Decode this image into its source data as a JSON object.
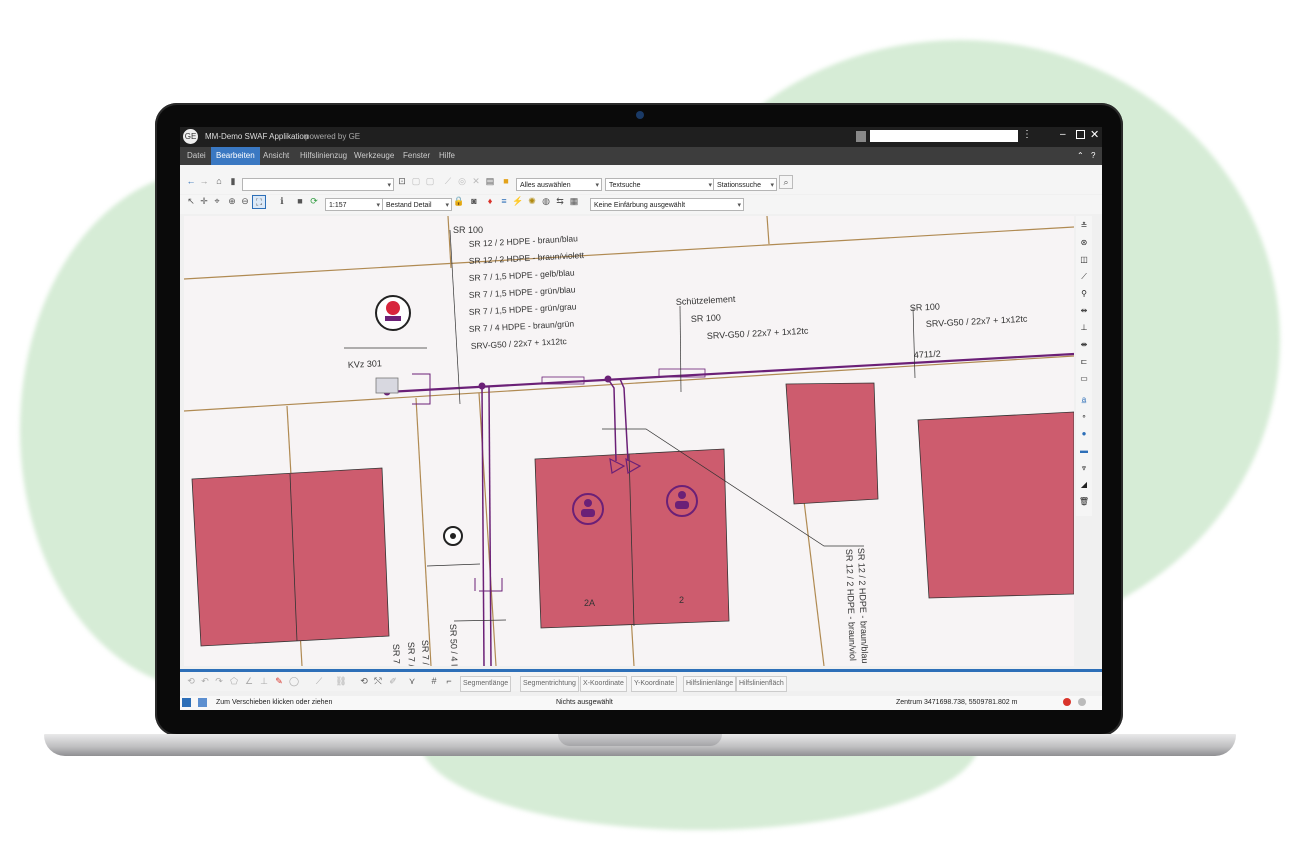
{
  "window": {
    "title": "MM-Demo SWAF Applikation",
    "subtitle": "powered by GE"
  },
  "menu": {
    "items": [
      {
        "label": "Datei",
        "active": false
      },
      {
        "label": "Bearbeiten",
        "active": true
      },
      {
        "label": "Ansicht",
        "active": false
      },
      {
        "label": "Hilfslinienzug",
        "active": false
      },
      {
        "label": "Werkzeuge",
        "active": false
      },
      {
        "label": "Fenster",
        "active": false
      },
      {
        "label": "Hilfe",
        "active": false
      }
    ]
  },
  "toolbar": {
    "select_all_label": "Alles auswählen",
    "text_search_label": "Textsuche",
    "station_search_label": "Stationssuche",
    "scale_value": "1:157",
    "view_label": "Bestand Detail",
    "coloring_label": "Keine Einfärbung ausgewählt"
  },
  "map_labels": {
    "sr100_left": "SR 100",
    "cable_lines": [
      "SR 12 / 2 HDPE - braun/blau",
      "SR 12 / 2 HDPE - braun/violett",
      "SR 7 / 1,5 HDPE - gelb/blau",
      "SR 7 / 1,5 HDPE - grün/blau",
      "SR 7 / 1,5 HDPE - grün/grau",
      "SR 7 / 4 HDPE - braun/grün",
      "SRV-G50 / 22x7 + 1x12tc"
    ],
    "kvz": "KVz 301",
    "schutzelement": "Schützelement",
    "sr100_mid": "SR 100",
    "srv_mid": "SRV-G50 / 22x7 + 1x12tc",
    "sr100_right": "SR 100",
    "srv_right": "SRV-G50 / 22x7 + 1x12tc",
    "number_right": "4711/2",
    "house_2a": "2A",
    "house_2": "2",
    "vert_right_1": "SR 12 / 2 HDPE - braun/blau",
    "vert_right_2": "SR 12 / 2 HDPE - braun/viol",
    "vert_bottom": [
      "SR 50 / 4 I",
      "SR 7 /",
      "SR 7 /",
      "SR 7"
    ]
  },
  "bottom_tabs": [
    "Segmentlänge",
    "Segmentrichtung",
    "X-Koordinate",
    "Y-Koordinate",
    "Hilfslinienlänge",
    "Hilfslinienfläch"
  ],
  "status": {
    "left": "Zum Verschieben klicken oder ziehen",
    "middle": "Nichts ausgewählt",
    "right": "Zentrum 3471698.738, 5509781.802 m"
  },
  "colors": {
    "house_fill": "#cd5c6e",
    "cable": "#6b2077",
    "parcel_line": "#b08a52",
    "accent": "#3a78c2"
  }
}
